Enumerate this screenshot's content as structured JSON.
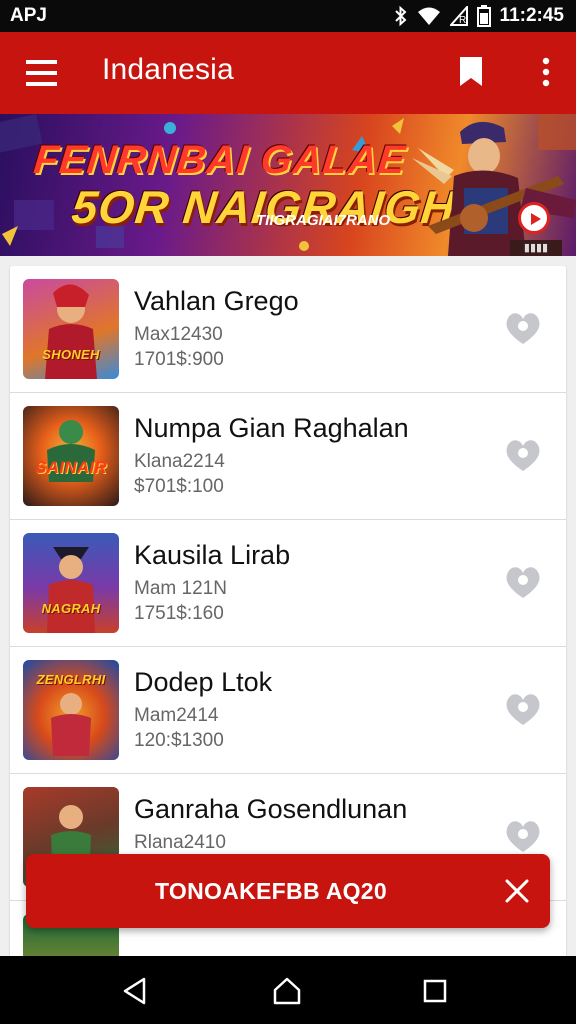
{
  "status_bar": {
    "carrier": "APJ",
    "time": "11:2:45",
    "icons": [
      "bluetooth-icon",
      "wifi-icon",
      "signal-icon",
      "battery-icon"
    ]
  },
  "app_bar": {
    "title": "Indanesia",
    "icons": [
      "menu-icon",
      "bookmark-icon",
      "more-vert-icon"
    ],
    "color": "#c8140f"
  },
  "banner": {
    "line1": "FENRNBAI GALAE",
    "line2": "5OR NAIGRAIGH !",
    "tagline": "TIIGRAGIAI7RANO"
  },
  "list": {
    "items": [
      {
        "title": "Vahlan Grego",
        "subtitle": "Max12430",
        "price": "1701$:900",
        "thumb_label": "SHONEH",
        "thumb_colors": [
          "#b03a8a",
          "#e0762a"
        ],
        "icon": "favorite-icon"
      },
      {
        "title": "Numpa Gian Raghalan",
        "subtitle": "Klana2214",
        "price": "$701$:100",
        "thumb_label": "SAINAIR",
        "thumb_colors": [
          "#1a2a1a",
          "#e8601a"
        ],
        "icon": "favorite-icon"
      },
      {
        "title": "Kausila Lirab",
        "subtitle": "Mam 121N",
        "price": "1751$:160",
        "thumb_label": "NAGRAH",
        "thumb_colors": [
          "#2a3a9a",
          "#c8402a"
        ],
        "icon": "favorite-icon"
      },
      {
        "title": "Dodep Ltok",
        "subtitle": "Mam2414",
        "price": "120:$1300",
        "thumb_label": "ZENGLRHI",
        "thumb_colors": [
          "#1a4aa8",
          "#e85a1a"
        ],
        "icon": "favorite-icon"
      },
      {
        "title": "Ganraha Gosendlunan",
        "subtitle": "Rlana2410",
        "price": "",
        "thumb_label": "",
        "thumb_colors": [
          "#8a2a1a",
          "#2a6a3a"
        ],
        "icon": "favorite-icon"
      },
      {
        "title": "",
        "subtitle": "",
        "price": "",
        "thumb_label": "",
        "thumb_colors": [
          "#1a6a3a",
          "#c8a02a"
        ],
        "icon": "favorite-icon"
      }
    ]
  },
  "snackbar": {
    "text": "TONOAKEFBB AQ20",
    "close_icon": "close-icon"
  },
  "nav_bar": {
    "icons": [
      "back-icon",
      "home-icon",
      "recents-icon"
    ]
  }
}
